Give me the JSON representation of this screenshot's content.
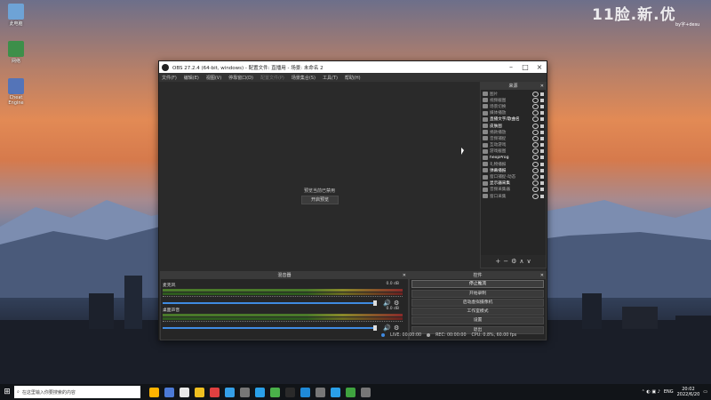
{
  "desktop": {
    "icons": [
      {
        "label": "此电脑",
        "color": "#6ea3d6",
        "icon": "computer-icon"
      },
      {
        "label": "网络",
        "color": "#3d8f4a",
        "icon": "network-icon"
      },
      {
        "label": "Cheat Engine",
        "color": "#5474b8",
        "icon": "cheat-engine-icon"
      }
    ],
    "watermark": "11脸.新.优",
    "watermark_sub": "by字+desu"
  },
  "obs": {
    "title": "OBS 27.2.4 (64-bit, windows) - 配置文件: 直播用 - 场景: 未命名 2",
    "menu": [
      "文件(F)",
      "编辑(E)",
      "视图(V)",
      "停靠窗口(D)",
      "配置文件(P)",
      "场景集合(S)",
      "工具(T)",
      "帮助(H)"
    ],
    "menu_disabled_index": 4,
    "preview_message": "预览当前已禁用",
    "preview_button": "开启预览",
    "sources": {
      "title": "来源",
      "items": [
        {
          "name": "图片",
          "hl": false
        },
        {
          "name": "视频截图",
          "hl": false
        },
        {
          "name": "场景切换",
          "hl": false
        },
        {
          "name": "媒体播放",
          "hl": false
        },
        {
          "name": "直播文字/歌曲名",
          "hl": true
        },
        {
          "name": "皮肤图",
          "hl": true
        },
        {
          "name": "捐款播放",
          "hl": false
        },
        {
          "name": "音频捕捉",
          "hl": false
        },
        {
          "name": "互动游戏",
          "hl": false
        },
        {
          "name": "游戏截图",
          "hl": false
        },
        {
          "name": "hexpProg",
          "hl": true
        },
        {
          "name": "礼物播报",
          "hl": false
        },
        {
          "name": "弹幕播报",
          "hl": true
        },
        {
          "name": "窗口捕捉-动态",
          "hl": false
        },
        {
          "name": "显示器采集",
          "hl": true
        },
        {
          "name": "音频采集器",
          "hl": false
        },
        {
          "name": "窗口采集",
          "hl": false
        }
      ],
      "toolbar": [
        "+",
        "−",
        "⚙",
        "∧",
        "∨"
      ]
    },
    "mixer": {
      "title": "混音器",
      "tracks": [
        {
          "name": "麦克风",
          "db": "0.0 dB"
        },
        {
          "name": "桌面声音",
          "db": "0.0 dB"
        }
      ]
    },
    "controls": {
      "title": "控件",
      "buttons": [
        "停止推流",
        "开始录制",
        "启动虚拟摄像机",
        "工作室模式",
        "设置",
        "退出"
      ]
    },
    "status": {
      "live": "LIVE: 00:00:00",
      "rec": "REC: 00:00:00",
      "cpu": "CPU: 0.8%, 60.00 fps"
    }
  },
  "taskbar": {
    "search_placeholder": "在这里输入你要搜索的内容",
    "apps": [
      "#ffb400",
      "#4c7ad6",
      "#e9e9e9",
      "#f0c020",
      "#e04040",
      "#35a0e8",
      "#777777",
      "#2aa0e8",
      "#4ab04a",
      "#2a2a2a",
      "#1f8ad8",
      "#777777",
      "#2aa0e8",
      "#3fa33f",
      "#777777"
    ],
    "lang": "ENG",
    "time": "20:02",
    "date": "2022/6/20"
  }
}
